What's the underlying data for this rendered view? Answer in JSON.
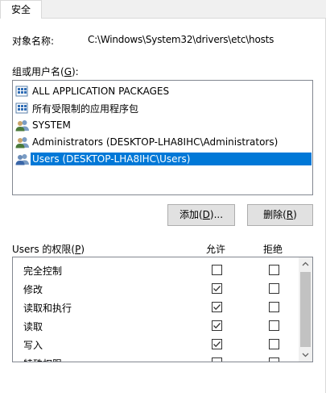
{
  "tab": {
    "label": "安全"
  },
  "object": {
    "label": "对象名称:",
    "value": "C:\\Windows\\System32\\drivers\\etc\\hosts"
  },
  "groups": {
    "label": "组或用户名(G):",
    "items": [
      {
        "name": "ALL APPLICATION PACKAGES",
        "icon": "app-package-icon"
      },
      {
        "name": "所有受限制的应用程序包",
        "icon": "app-package-icon"
      },
      {
        "name": "SYSTEM",
        "icon": "user-group-icon"
      },
      {
        "name": "Administrators (DESKTOP-LHA8IHC\\Administrators)",
        "icon": "user-group-icon"
      },
      {
        "name": "Users (DESKTOP-LHA8IHC\\Users)",
        "icon": "user-group-icon",
        "selected": true
      }
    ]
  },
  "buttons": {
    "add": "添加(D)...",
    "remove": "删除(R)"
  },
  "permissions": {
    "label": "Users 的权限(P)",
    "allow_header": "允许",
    "deny_header": "拒绝",
    "rows": [
      {
        "name": "完全控制",
        "allow": false,
        "deny": false
      },
      {
        "name": "修改",
        "allow": true,
        "deny": false
      },
      {
        "name": "读取和执行",
        "allow": true,
        "deny": false
      },
      {
        "name": "读取",
        "allow": true,
        "deny": false
      },
      {
        "name": "写入",
        "allow": true,
        "deny": false
      },
      {
        "name": "特殊权限",
        "allow": false,
        "deny": false
      }
    ]
  },
  "colors": {
    "selection": "#0078d7",
    "check": "#333333"
  }
}
